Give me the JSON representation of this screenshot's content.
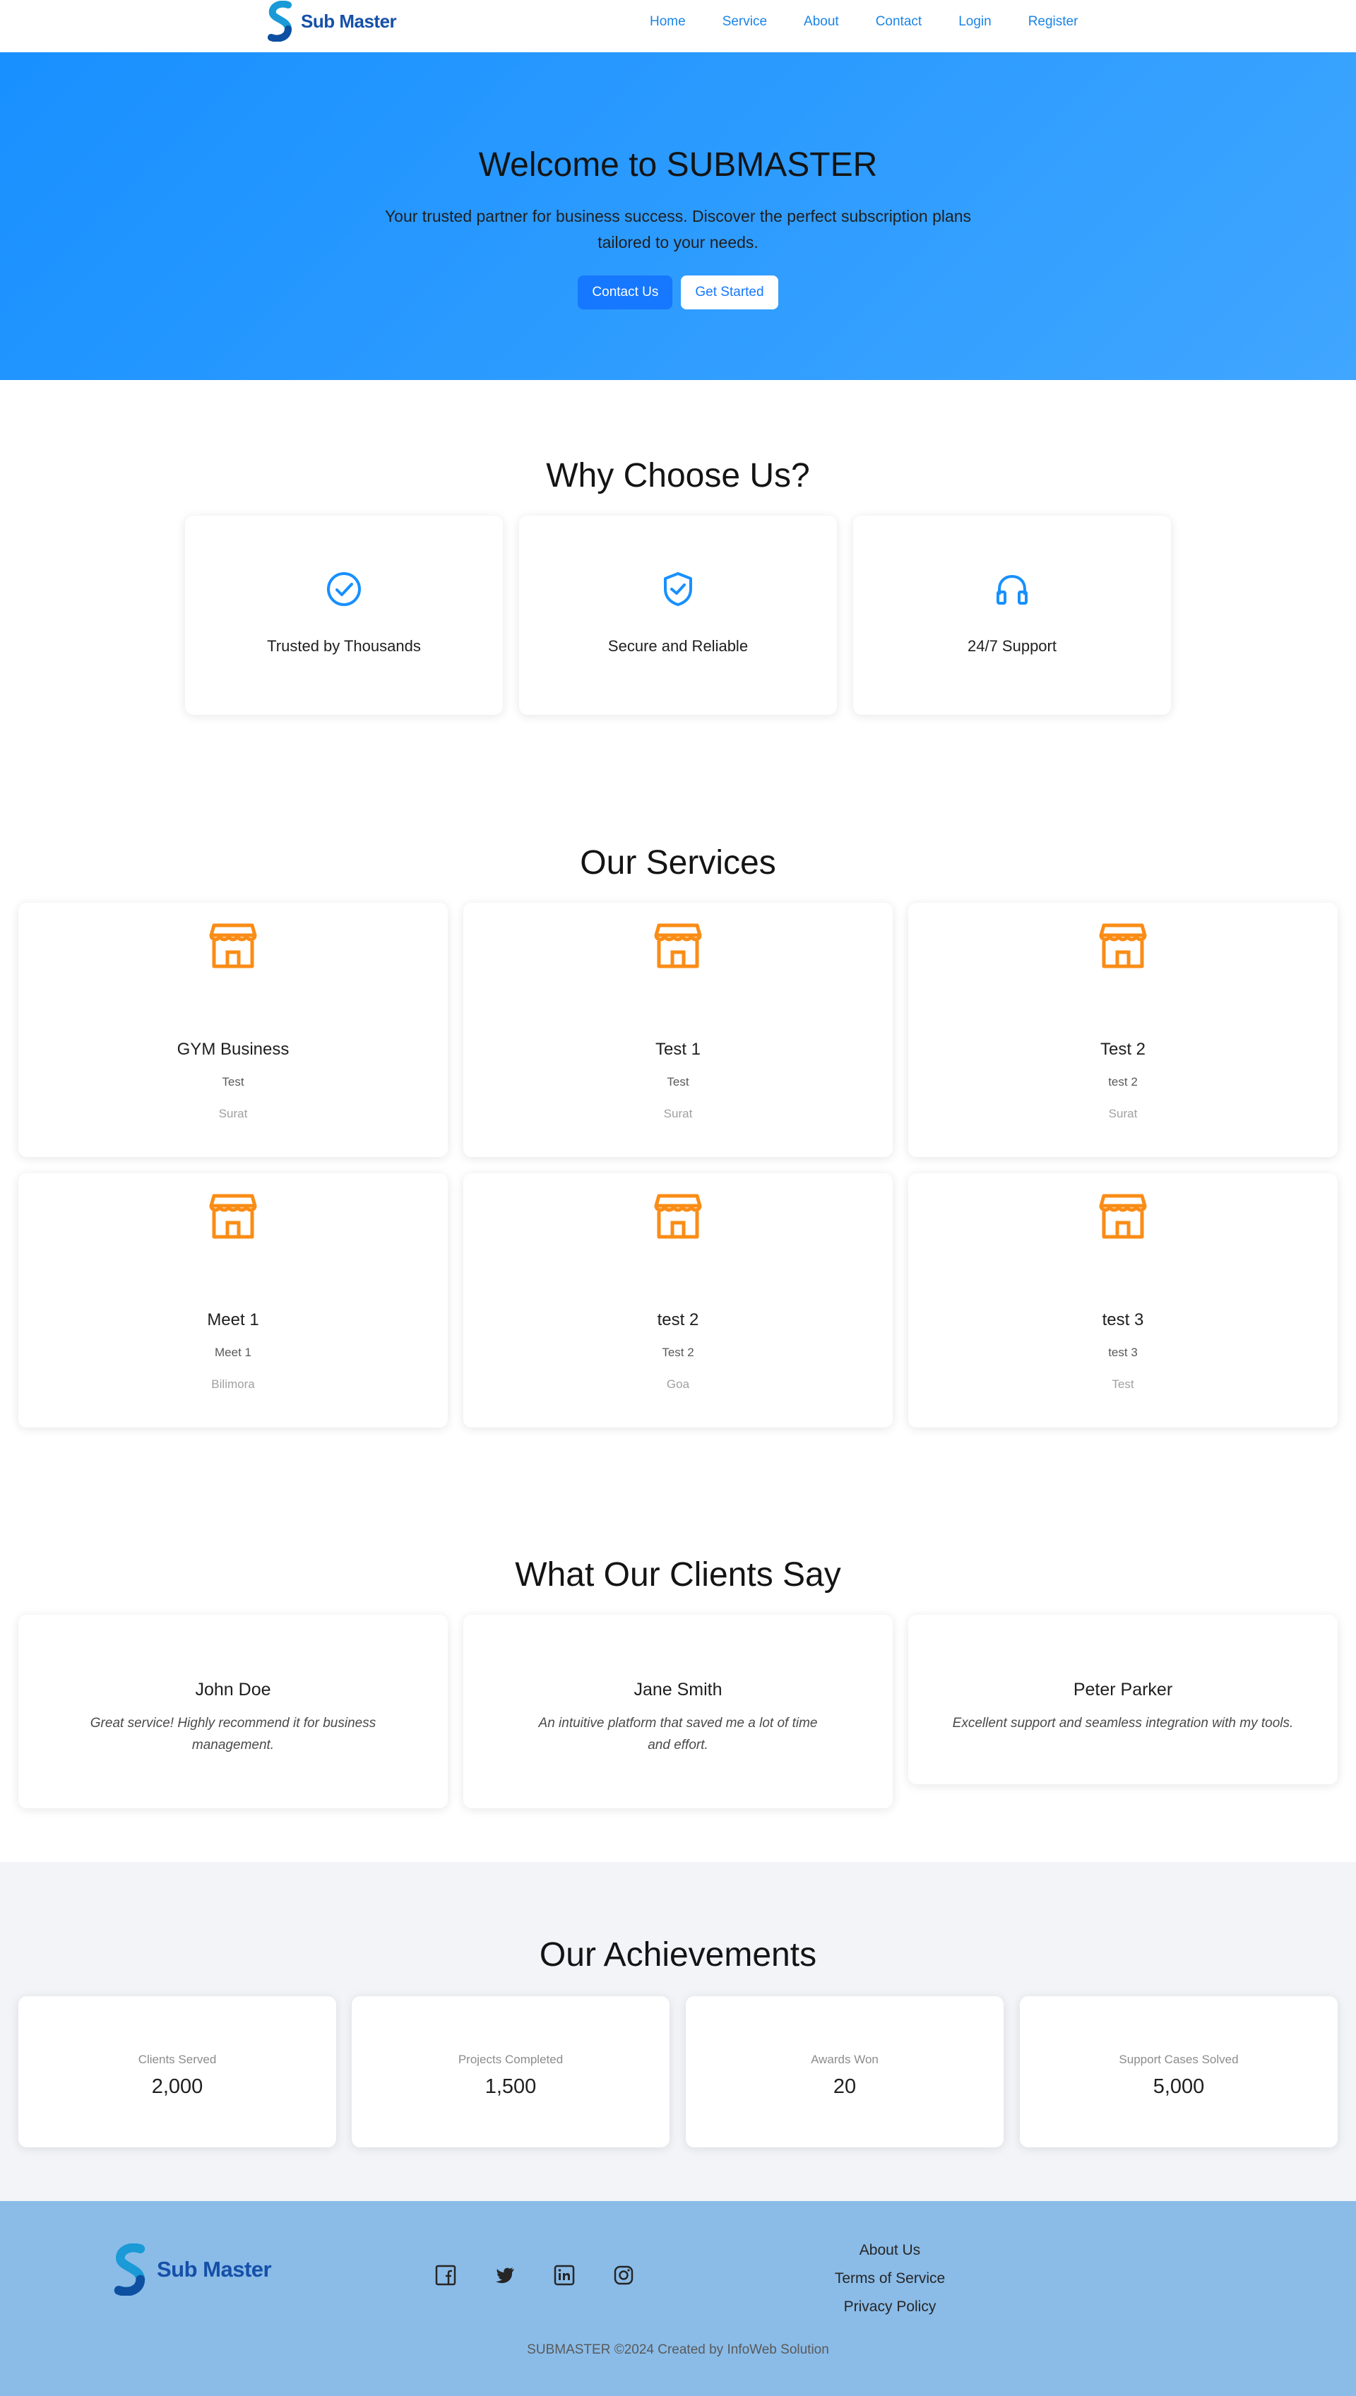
{
  "brand": {
    "name": "Sub Master"
  },
  "nav": {
    "items": [
      {
        "label": "Home"
      },
      {
        "label": "Service"
      },
      {
        "label": "About"
      },
      {
        "label": "Contact"
      },
      {
        "label": "Login"
      },
      {
        "label": "Register"
      }
    ]
  },
  "hero": {
    "title": "Welcome to SUBMASTER",
    "subtitle": "Your trusted partner for business success. Discover the perfect subscription plans tailored to your needs.",
    "primary_button": "Contact Us",
    "secondary_button": "Get Started"
  },
  "why": {
    "title": "Why Choose Us?",
    "items": [
      {
        "label": "Trusted by Thousands",
        "icon": "check-circle-icon"
      },
      {
        "label": "Secure and Reliable",
        "icon": "shield-check-icon"
      },
      {
        "label": "24/7 Support",
        "icon": "headphones-icon"
      }
    ]
  },
  "services": {
    "title": "Our Services",
    "icon": "shop-icon",
    "items": [
      {
        "title": "GYM Business",
        "description": "Test",
        "location": "Surat"
      },
      {
        "title": "Test 1",
        "description": "Test",
        "location": "Surat"
      },
      {
        "title": "Test 2",
        "description": "test 2",
        "location": "Surat"
      },
      {
        "title": "Meet 1",
        "description": "Meet 1",
        "location": "Bilimora"
      },
      {
        "title": "test 2",
        "description": "Test 2",
        "location": "Goa"
      },
      {
        "title": "test 3",
        "description": "test 3",
        "location": "Test"
      }
    ]
  },
  "testimonials": {
    "title": "What Our Clients Say",
    "items": [
      {
        "name": "John Doe",
        "quote": "Great service! Highly recommend it for business management."
      },
      {
        "name": "Jane Smith",
        "quote": "An intuitive platform that saved me a lot of time and effort."
      },
      {
        "name": "Peter Parker",
        "quote": "Excellent support and seamless integration with my tools."
      }
    ]
  },
  "achievements": {
    "title": "Our Achievements",
    "items": [
      {
        "label": "Clients Served",
        "value": "2,000"
      },
      {
        "label": "Projects Completed",
        "value": "1,500"
      },
      {
        "label": "Awards Won",
        "value": "20"
      },
      {
        "label": "Support Cases Solved",
        "value": "5,000"
      }
    ]
  },
  "footer": {
    "socials": [
      "facebook-icon",
      "twitter-icon",
      "linkedin-icon",
      "instagram-icon"
    ],
    "links": [
      {
        "label": "About Us"
      },
      {
        "label": "Terms of Service"
      },
      {
        "label": "Privacy Policy"
      }
    ],
    "copyright": "SUBMASTER ©2024 Created by InfoWeb Solution"
  },
  "colors": {
    "primary": "#1677ff",
    "link": "#1b84e6",
    "brand": "#1550a8",
    "service_icon": "#fa8c16",
    "footer_bg": "#8bbce8",
    "achievements_bg": "#f2f4f8"
  }
}
